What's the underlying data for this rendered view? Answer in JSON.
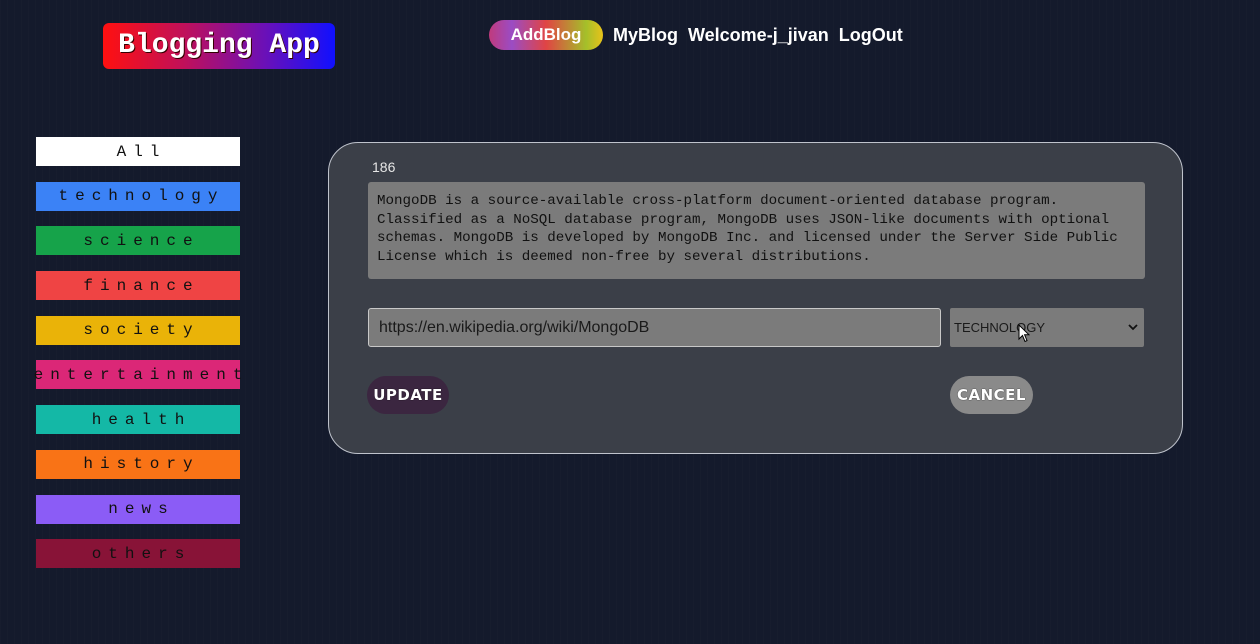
{
  "header": {
    "logo": "Blogging App",
    "nav": {
      "add_blog": "AddBlog",
      "my_blog": "MyBlog",
      "welcome": "Welcome-j_jivan",
      "logout": "LogOut"
    }
  },
  "sidebar": {
    "items": [
      {
        "label": "All",
        "color": "#ffffff"
      },
      {
        "label": "technology",
        "color": "#3b82f6"
      },
      {
        "label": "science",
        "color": "#16a34a"
      },
      {
        "label": "finance",
        "color": "#ef4444"
      },
      {
        "label": "society",
        "color": "#eab308"
      },
      {
        "label": "entertainment",
        "color": "#db2777"
      },
      {
        "label": "health",
        "color": "#14b8a6"
      },
      {
        "label": "history",
        "color": "#f97316"
      },
      {
        "label": "news",
        "color": "#8b5cf6"
      },
      {
        "label": "others",
        "color": "#881337"
      }
    ]
  },
  "editor": {
    "blog_id": "186",
    "description": "MongoDB is a source-available cross-platform document-oriented database program.\nClassified as a NoSQL database program, MongoDB uses JSON-like documents with optional\nschemas. MongoDB is developed by MongoDB Inc. and licensed under the Server Side Public\nLicense which is deemed non-free by several distributions.",
    "url_value": "https://en.wikipedia.org/wiki/MongoDB",
    "category_selected": "TECHNOLOGY",
    "update_label": "UPDATE",
    "cancel_label": "CANCEL"
  }
}
